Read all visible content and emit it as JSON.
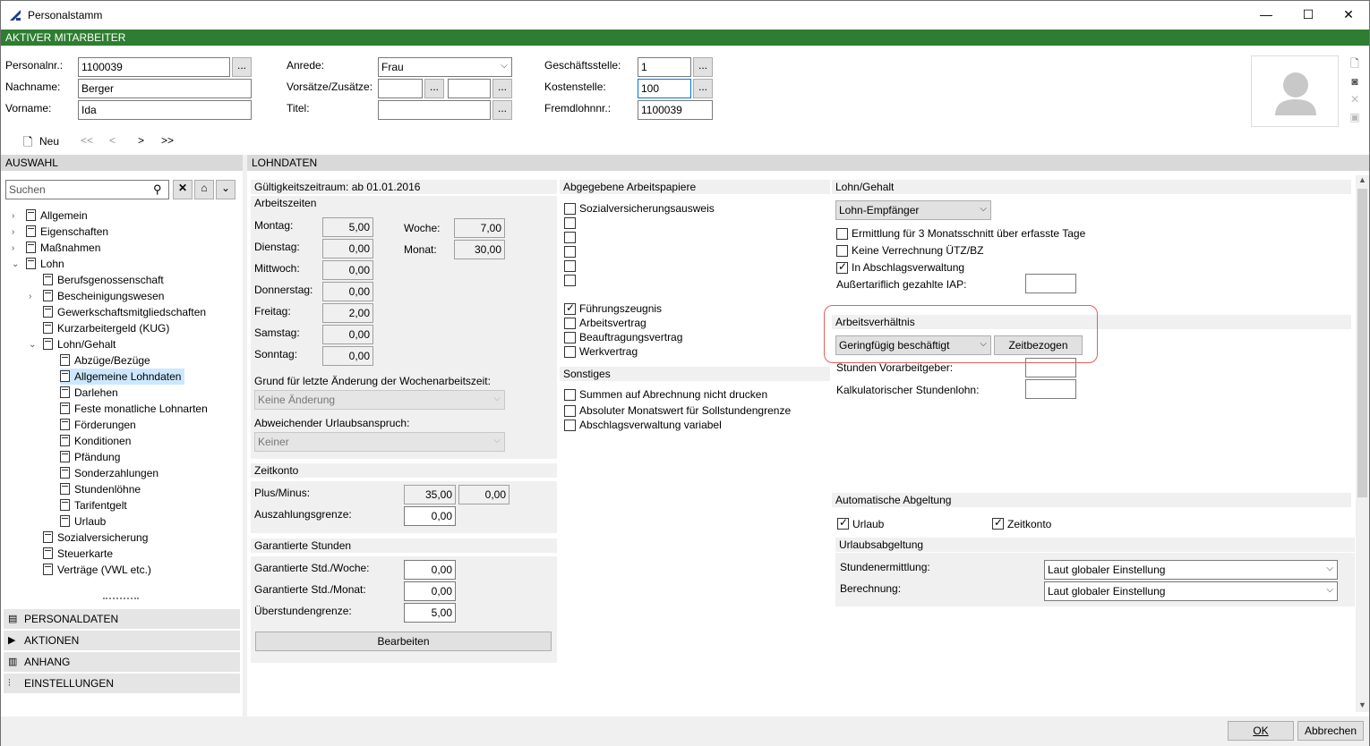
{
  "window": {
    "title": "Personalstamm",
    "minimize": "—",
    "maximize": "☐",
    "close": "✕"
  },
  "status_bar": "AKTIVER MITARBEITER",
  "header": {
    "personalnr_label": "Personalnr.:",
    "personalnr_value": "1100039",
    "nachname_label": "Nachname:",
    "nachname_value": "Berger",
    "vorname_label": "Vorname:",
    "vorname_value": "Ida",
    "anrede_label": "Anrede:",
    "anrede_value": "Frau",
    "vorsaetze_label": "Vorsätze/Zusätze:",
    "vorsaetze_value1": "",
    "vorsaetze_value2": "",
    "titel_label": "Titel:",
    "titel_value": "",
    "geschaeftsstelle_label": "Geschäftsstelle:",
    "geschaeftsstelle_value": "1",
    "kostenstelle_label": "Kostenstelle:",
    "kostenstelle_value": "100",
    "fremdlohnnr_label": "Fremdlohnnr.:",
    "fremdlohnnr_value": "1100039",
    "dots": "..."
  },
  "nav": {
    "new_label": "Neu",
    "first": "<<",
    "prev": "<",
    "next": ">",
    "last": ">>"
  },
  "left": {
    "section_title": "AUSWAHL",
    "search_placeholder": "Suchen",
    "tree": [
      {
        "label": "Allgemein"
      },
      {
        "label": "Eigenschaften"
      },
      {
        "label": "Maßnahmen"
      },
      {
        "label": "Lohn"
      },
      {
        "label": "Berufsgenossenschaft"
      },
      {
        "label": "Bescheinigungswesen"
      },
      {
        "label": "Gewerkschaftsmitgliedschaften"
      },
      {
        "label": "Kurzarbeitergeld (KUG)"
      },
      {
        "label": "Lohn/Gehalt"
      },
      {
        "label": "Abzüge/Bezüge"
      },
      {
        "label": "Allgemeine Lohndaten"
      },
      {
        "label": "Darlehen"
      },
      {
        "label": "Feste monatliche Lohnarten"
      },
      {
        "label": "Förderungen"
      },
      {
        "label": "Konditionen"
      },
      {
        "label": "Pfändung"
      },
      {
        "label": "Sonderzahlungen"
      },
      {
        "label": "Stundenlöhne"
      },
      {
        "label": "Tarifentgelt"
      },
      {
        "label": "Urlaub"
      },
      {
        "label": "Sozialversicherung"
      },
      {
        "label": "Steuerkarte"
      },
      {
        "label": "Verträge (VWL etc.)"
      }
    ],
    "bottom_nav": [
      "PERSONALDATEN",
      "AKTIONEN",
      "ANHANG",
      "EINSTELLUNGEN"
    ]
  },
  "right": {
    "section_title": "LOHNDATEN",
    "gueltig": "Gültigkeitszeitraum: ab 01.01.2016",
    "arbeitszeiten_title": "Arbeitszeiten",
    "days": [
      {
        "label": "Montag:",
        "value": "5,00"
      },
      {
        "label": "Dienstag:",
        "value": "0,00"
      },
      {
        "label": "Mittwoch:",
        "value": "0,00"
      },
      {
        "label": "Donnerstag:",
        "value": "0,00"
      },
      {
        "label": "Freitag:",
        "value": "2,00"
      },
      {
        "label": "Samstag:",
        "value": "0,00"
      },
      {
        "label": "Sonntag:",
        "value": "0,00"
      }
    ],
    "woche_label": "Woche:",
    "woche_value": "7,00",
    "monat_label": "Monat:",
    "monat_value": "30,00",
    "grund_label": "Grund für letzte Änderung der Wochenarbeitszeit:",
    "grund_value": "Keine Änderung",
    "urlaub_label": "Abweichender Urlaubsanspruch:",
    "urlaub_value": "Keiner",
    "zeitkonto_title": "Zeitkonto",
    "plusminus_label": "Plus/Minus:",
    "plusminus_value1": "35,00",
    "plusminus_value2": "0,00",
    "auszahlung_label": "Auszahlungsgrenze:",
    "auszahlung_value": "0,00",
    "garantiert_title": "Garantierte Stunden",
    "garantiert_woche_label": "Garantierte Std./Woche:",
    "garantiert_woche_value": "0,00",
    "garantiert_monat_label": "Garantierte Std./Monat:",
    "garantiert_monat_value": "0,00",
    "ueberstunden_label": "Überstundengrenze:",
    "ueberstunden_value": "5,00",
    "bearbeiten_label": "Bearbeiten",
    "arbeitspapiere_title": "Abgegebene Arbeitspapiere",
    "arbeitspapiere": [
      {
        "label": "Sozialversicherungsausweis",
        "checked": false
      },
      {
        "label": "",
        "checked": false
      },
      {
        "label": "",
        "checked": false
      },
      {
        "label": "",
        "checked": false
      },
      {
        "label": "",
        "checked": false
      },
      {
        "label": "",
        "checked": false
      },
      {
        "label": "Führungszeugnis",
        "checked": true
      },
      {
        "label": "Arbeitsvertrag",
        "checked": false
      },
      {
        "label": "Beauftragungsvertrag",
        "checked": false
      },
      {
        "label": "Werkvertrag",
        "checked": false
      }
    ],
    "sonstiges_title": "Sonstiges",
    "sonstiges": [
      {
        "label": "Summen auf Abrechnung nicht drucken",
        "checked": false
      },
      {
        "label": "Absoluter Monatswert für Sollstundengrenze",
        "checked": false
      },
      {
        "label": "Abschlagsverwaltung variabel",
        "checked": false
      }
    ],
    "lohngehalt_title": "Lohn/Gehalt",
    "lohngehalt_value": "Lohn-Empfänger",
    "lohngehalt_checks": [
      {
        "label": "Ermittlung für 3 Monatsschnitt über erfasste Tage",
        "checked": false
      },
      {
        "label": "Keine Verrechnung ÜTZ/BZ",
        "checked": false
      },
      {
        "label": "In Abschlagsverwaltung",
        "checked": true
      }
    ],
    "iap_label": "Außertariflich gezahlte IAP:",
    "arbeitsverhaeltnis_title": "Arbeitsverhältnis",
    "arbeitsverhaeltnis_value": "Geringfügig beschäftigt",
    "zeitbezogen_label": "Zeitbezogen",
    "vorarbeitgeber_label": "Stunden Vorarbeitgeber:",
    "kalk_label": "Kalkulatorischer Stundenlohn:",
    "auto_title": "Automatische Abgeltung",
    "auto_urlaub": "Urlaub",
    "auto_zeitkonto": "Zeitkonto",
    "urlaubsabgeltung_title": "Urlaubsabgeltung",
    "stundenermittlung_label": "Stundenermittlung:",
    "stundenermittlung_value": "Laut globaler Einstellung",
    "berechnung_label": "Berechnung:",
    "berechnung_value": "Laut globaler Einstellung"
  },
  "footer": {
    "ok": "OK",
    "abbrechen": "Abbrechen"
  }
}
